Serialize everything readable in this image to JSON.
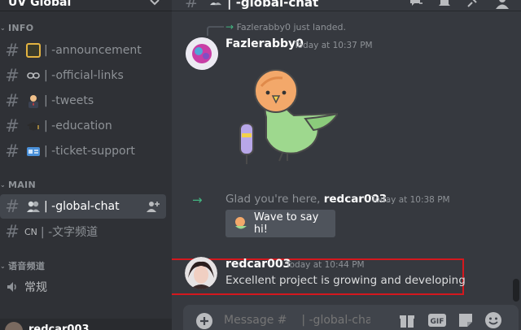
{
  "server": {
    "name": "UV Global"
  },
  "sidebar": {
    "categories": [
      {
        "label": "INFO"
      },
      {
        "label": "MAIN"
      },
      {
        "label": "语音频道"
      }
    ],
    "channels": [
      {
        "label": "| -announcement"
      },
      {
        "label": "| -official-links"
      },
      {
        "label": "| -tweets"
      },
      {
        "label": "| -education"
      },
      {
        "label": "| -ticket-support"
      },
      {
        "label": "| -global-chat"
      },
      {
        "prefix": "CN",
        "label": "| -文字频道"
      }
    ],
    "voice": {
      "label": "常规"
    },
    "user": {
      "name": "redcar003"
    }
  },
  "header": {
    "channel": "| -global-chat"
  },
  "messages": {
    "system_join": {
      "text": "Fazlerabby0 just landed."
    },
    "fazle": {
      "author": "Fazlerabby0",
      "time": "Today at 10:37 PM"
    },
    "welcome": {
      "prefix": "Glad you're here, ",
      "user": "redcar003",
      "suffix": ".",
      "time": "Today at 10:38 PM"
    },
    "wave": {
      "label": "Wave to say hi!"
    },
    "redcar": {
      "author": "redcar003",
      "time": "Today at 10:44 PM",
      "text": "Excellent project is growing and developing"
    }
  },
  "composer": {
    "placeholder": "Message #    | -global-chat"
  },
  "colors": {
    "accent_green": "#43b581",
    "highlight_red": "#d4181e"
  }
}
